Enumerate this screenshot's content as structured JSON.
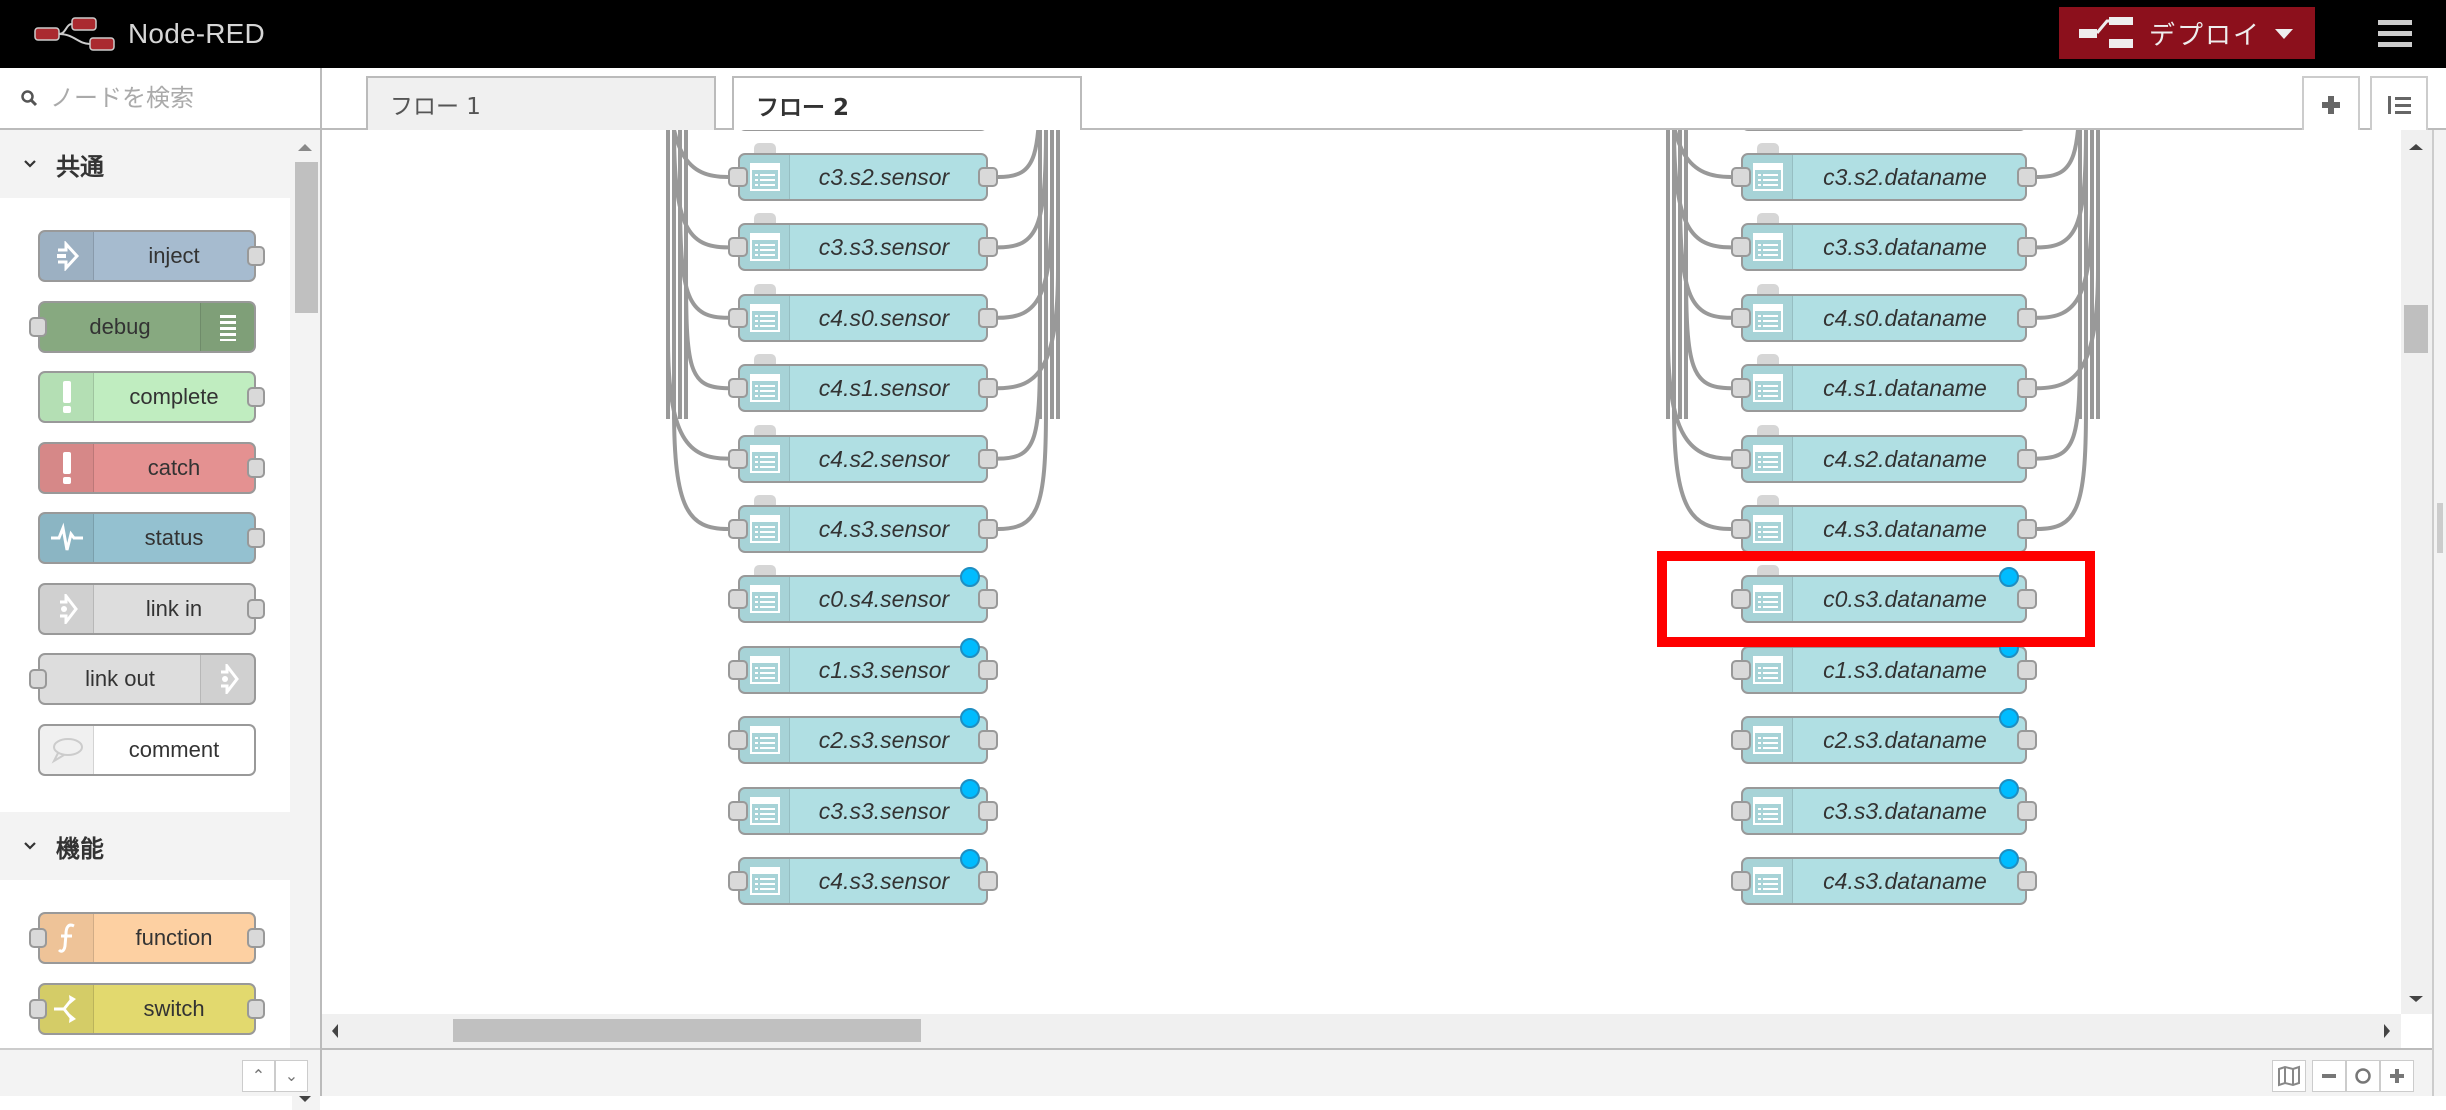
{
  "header": {
    "app_title": "Node-RED",
    "deploy_label": "デプロイ",
    "colors": {
      "header_bg": "#000000",
      "deploy_bg": "#8c101c",
      "logo_red": "#aa2a2f"
    }
  },
  "palette": {
    "search_placeholder": "ノードを検索",
    "categories": [
      {
        "label": "共通",
        "nodes": [
          {
            "label": "inject",
            "color": "#a6bbcf",
            "icon": "arrow-in-icon",
            "icon_side": "left",
            "in": false,
            "out": true
          },
          {
            "label": "debug",
            "color": "#87a980",
            "icon": "list-lines-icon",
            "icon_side": "right",
            "in": true,
            "out": false
          },
          {
            "label": "complete",
            "color": "#c0edc0",
            "icon": "exclamation-icon",
            "icon_side": "left",
            "in": false,
            "out": true
          },
          {
            "label": "catch",
            "color": "#e49191",
            "icon": "exclamation-icon",
            "icon_side": "left",
            "in": false,
            "out": true
          },
          {
            "label": "status",
            "color": "#94c1d0",
            "icon": "pulse-icon",
            "icon_side": "left",
            "in": false,
            "out": true
          },
          {
            "label": "link in",
            "color": "#dddddd",
            "icon": "link-icon",
            "icon_side": "left",
            "in": false,
            "out": true
          },
          {
            "label": "link out",
            "color": "#dddddd",
            "icon": "link-icon",
            "icon_side": "right",
            "in": true,
            "out": false
          },
          {
            "label": "comment",
            "color": "#ffffff",
            "icon": "speech-bubble-icon",
            "icon_side": "left",
            "in": false,
            "out": false
          }
        ]
      },
      {
        "label": "機能",
        "nodes": [
          {
            "label": "function",
            "color": "#fdd0a2",
            "icon": "function-icon",
            "icon_side": "left",
            "in": true,
            "out": true
          },
          {
            "label": "switch",
            "color": "#e2d96e",
            "icon": "switch-icon",
            "icon_side": "left",
            "in": true,
            "out": true
          }
        ]
      }
    ]
  },
  "tabs": [
    {
      "label": "フロー 1",
      "active": false
    },
    {
      "label": "フロー 2",
      "active": true
    }
  ],
  "workspace": {
    "node_color": "#b0dfe3",
    "changed_badge_color": "#00bcff",
    "highlight_color": "#ff0000",
    "left_column": [
      {
        "label": "c3.s2.sensor",
        "changed": false,
        "wired": true
      },
      {
        "label": "c3.s3.sensor",
        "changed": false,
        "wired": true
      },
      {
        "label": "c4.s0.sensor",
        "changed": false,
        "wired": true
      },
      {
        "label": "c4.s1.sensor",
        "changed": false,
        "wired": true
      },
      {
        "label": "c4.s2.sensor",
        "changed": false,
        "wired": true
      },
      {
        "label": "c4.s3.sensor",
        "changed": false,
        "wired": true
      },
      {
        "label": "c0.s4.sensor",
        "changed": true,
        "wired": false
      },
      {
        "label": "c1.s3.sensor",
        "changed": true,
        "wired": false
      },
      {
        "label": "c2.s3.sensor",
        "changed": true,
        "wired": false
      },
      {
        "label": "c3.s3.sensor",
        "changed": true,
        "wired": false
      },
      {
        "label": "c4.s3.sensor",
        "changed": true,
        "wired": false
      }
    ],
    "right_column": [
      {
        "label": "c3.s2.dataname",
        "changed": false,
        "wired": true
      },
      {
        "label": "c3.s3.dataname",
        "changed": false,
        "wired": true
      },
      {
        "label": "c4.s0.dataname",
        "changed": false,
        "wired": true
      },
      {
        "label": "c4.s1.dataname",
        "changed": false,
        "wired": true
      },
      {
        "label": "c4.s2.dataname",
        "changed": false,
        "wired": true
      },
      {
        "label": "c4.s3.dataname",
        "changed": false,
        "wired": true
      },
      {
        "label": "c0.s3.dataname",
        "changed": true,
        "wired": false,
        "highlighted": true
      },
      {
        "label": "c1.s3.dataname",
        "changed": true,
        "wired": false
      },
      {
        "label": "c2.s3.dataname",
        "changed": true,
        "wired": false
      },
      {
        "label": "c3.s3.dataname",
        "changed": true,
        "wired": false
      },
      {
        "label": "c4.s3.dataname",
        "changed": true,
        "wired": false
      }
    ]
  },
  "footer": {
    "buttons": [
      "navigator",
      "zoom-out",
      "zoom-reset",
      "zoom-in"
    ]
  }
}
